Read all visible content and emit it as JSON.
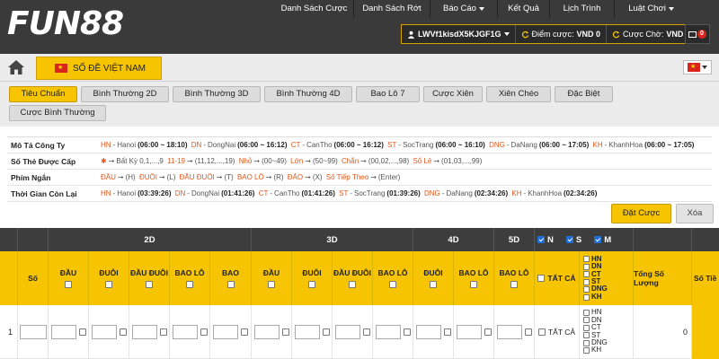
{
  "header": {
    "logo": "FUN88",
    "nav": [
      {
        "label": "Danh Sách Cược",
        "has_caret": false
      },
      {
        "label": "Danh Sách Rớt",
        "has_caret": false
      },
      {
        "label": "Báo Cáo",
        "has_caret": true
      },
      {
        "label": "Kết Quả",
        "has_caret": false
      },
      {
        "label": "Lịch Trình",
        "has_caret": false
      },
      {
        "label": "Luật Chơi",
        "has_caret": true
      }
    ],
    "account": {
      "username": "LWVf1kisdX5KJGF1G",
      "points_label": "Điểm cược:",
      "points_value": "VND 0",
      "pending_label": "Cược Chờ:",
      "pending_value": "VND 0"
    },
    "mail_count": "0"
  },
  "lottery": {
    "current": "SỐ ĐỀ VIỆT NAM"
  },
  "bet_tabs": [
    {
      "label": "Tiêu Chuẩn",
      "active": true
    },
    {
      "label": "Bình Thường 2D",
      "active": false
    },
    {
      "label": "Bình Thường 3D",
      "active": false
    },
    {
      "label": "Bình Thường 4D",
      "active": false
    },
    {
      "label": "Bao Lô 7",
      "active": false
    },
    {
      "label": "Cược Xiên",
      "active": false
    },
    {
      "label": "Xiên Chéo",
      "active": false
    },
    {
      "label": "Đặc Biệt",
      "active": false
    },
    {
      "label": "Cược Bình Thường",
      "active": false
    }
  ],
  "info": {
    "companies_label": "Mô Tả Công Ty",
    "companies": [
      {
        "code": "HN",
        "name": "Hanoi",
        "time": "(06:00 ~ 18:10)"
      },
      {
        "code": "DN",
        "name": "DongNai",
        "time": "(06:00 ~ 16:12)"
      },
      {
        "code": "CT",
        "name": "CanTho",
        "time": "(06:00 ~ 16:12)"
      },
      {
        "code": "ST",
        "name": "SocTrang",
        "time": "(06:00 ~ 16:10)"
      },
      {
        "code": "DNG",
        "name": "DaNang",
        "time": "(06:00 ~ 17:05)"
      },
      {
        "code": "KH",
        "name": "KhanhHoa",
        "time": "(06:00 ~ 17:05)"
      }
    ],
    "numbers_label": "Số Thẻ Được Cấp",
    "numbers": [
      {
        "code": "✱",
        "desc": "Bất Kỳ 0,1,...,9"
      },
      {
        "code": "11-19",
        "desc": "(11,12,...,19)"
      },
      {
        "code": "Nhỏ",
        "desc": "(00~49)"
      },
      {
        "code": "Lớn",
        "desc": "(50~99)"
      },
      {
        "code": "Chẵn",
        "desc": "(00,02,...,98)"
      },
      {
        "code": "Số Lẻ",
        "desc": "(01,03,...,99)"
      }
    ],
    "shortcuts_label": "Phím Ngắn",
    "shortcuts": [
      {
        "code": "ĐẦU",
        "key": "(H)"
      },
      {
        "code": "ĐUÔI",
        "key": "(L)"
      },
      {
        "code": "ĐẦU ĐUÔI",
        "key": "(T)"
      },
      {
        "code": "BAO LÔ",
        "key": "(R)"
      },
      {
        "code": "ĐẢO",
        "key": "(X)"
      },
      {
        "code": "Số Tiếp Theo",
        "key": "(Enter)"
      }
    ],
    "remaining_label": "Thời Gian Còn Lại",
    "remaining": [
      {
        "code": "HN",
        "name": "Hanoi",
        "time": "(03:39:26)"
      },
      {
        "code": "DN",
        "name": "DongNai",
        "time": "(01:41:26)"
      },
      {
        "code": "CT",
        "name": "CanTho",
        "time": "(01:41:26)"
      },
      {
        "code": "ST",
        "name": "SocTrang",
        "time": "(01:39:26)"
      },
      {
        "code": "DNG",
        "name": "DaNang",
        "time": "(02:34:26)"
      },
      {
        "code": "KH",
        "name": "KhanhHoa",
        "time": "(02:34:26)"
      }
    ]
  },
  "actions": {
    "bet": "Đặt Cược",
    "clear": "Xóa"
  },
  "grid": {
    "group_2d": "2D",
    "group_3d": "3D",
    "group_4d": "4D",
    "group_5d": "5D",
    "region_n": "N",
    "region_s": "S",
    "region_m": "M",
    "col_so": "Số",
    "cols_2d": [
      "ĐẦU",
      "ĐUÔI",
      "ĐẦU ĐUÔI",
      "BAO LÔ",
      "BAO"
    ],
    "cols_3d": [
      "ĐẦU",
      "ĐUÔI",
      "ĐẦU ĐUÔI",
      "BAO LÔ"
    ],
    "cols_4d": [
      "ĐUÔI",
      "BAO LÔ"
    ],
    "cols_5d": [
      "BAO LÔ"
    ],
    "select_all": "TẤT CẢ",
    "providers": [
      "HN",
      "DN",
      "CT",
      "ST",
      "DNG",
      "KH"
    ],
    "col_total_qty": "Tổng Số Lượng",
    "col_total_amt": "Số Tiề",
    "row": {
      "index": "1",
      "select_all": "TẤT CẢ",
      "total_qty": "0"
    }
  }
}
